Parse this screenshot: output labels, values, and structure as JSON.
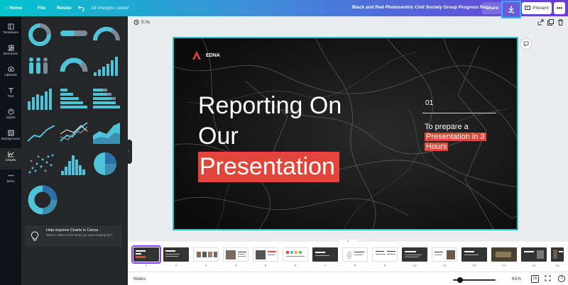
{
  "topbar": {
    "home_label": "Home",
    "file_label": "File",
    "resize_label": "Resize",
    "undo_icon": "undo-icon",
    "saved_status": "All changes saved",
    "doc_title": "Black and Red Photocentric Civil Society Group Progress Re...",
    "share_label": "Share",
    "download_icon": "download-icon",
    "present_label": "Present",
    "more_label": "•••",
    "gradient": [
      "#00c4cc",
      "#3f8ed9",
      "#6a3ad8"
    ]
  },
  "sidebar": {
    "items": [
      {
        "label": "Templates",
        "icon": "templates-icon"
      },
      {
        "label": "Elements",
        "icon": "elements-icon"
      },
      {
        "label": "Uploads",
        "icon": "uploads-icon"
      },
      {
        "label": "Text",
        "icon": "text-icon"
      },
      {
        "label": "Styles",
        "icon": "styles-icon"
      },
      {
        "label": "Background",
        "icon": "background-icon"
      },
      {
        "label": "Charts",
        "icon": "charts-icon",
        "active": true
      },
      {
        "label": "More",
        "icon": "more-icon"
      }
    ]
  },
  "charts_panel": {
    "help_title": "Help improve Charts in Canva",
    "help_body": "Weren't able to find what you were looking for?",
    "accent": "#4fc3d9"
  },
  "canvas": {
    "timer": "5.0s"
  },
  "slide": {
    "brand": "EDNA",
    "headline_line1": "Reporting On",
    "headline_line2": "Our",
    "headline_line3": "Presentation",
    "number": "01",
    "sub_line1": "To prepare a",
    "sub_line2": "Presentation in 3",
    "sub_line3": "Hours",
    "accent": "#e2463a"
  },
  "filmstrip": {
    "pages": [
      "1",
      "2",
      "3",
      "4",
      "5",
      "6",
      "7",
      "8",
      "9",
      "10",
      "11",
      "12",
      "13",
      "14",
      "15",
      "16"
    ]
  },
  "bottombar": {
    "notes_label": "Notes",
    "zoom": "61%",
    "page_count": "16",
    "help_label": "?"
  }
}
